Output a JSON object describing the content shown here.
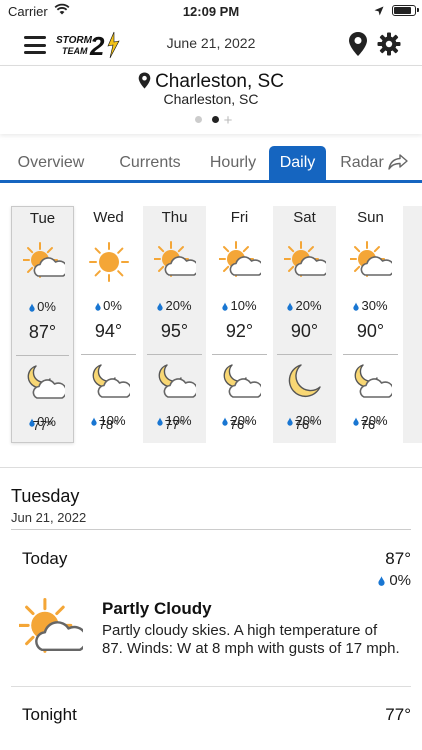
{
  "status_bar": {
    "carrier": "Carrier",
    "time": "12:09 PM",
    "battery_level": 0.9
  },
  "header": {
    "date": "June 21, 2022"
  },
  "location": {
    "title": "Charleston, SC",
    "subtitle": "Charleston, SC",
    "pages": 2,
    "active_page": 1
  },
  "tabs": [
    {
      "label": "Overview"
    },
    {
      "label": "Currents"
    },
    {
      "label": "Hourly"
    },
    {
      "label": "Daily",
      "active": true
    },
    {
      "label": "Radar"
    }
  ],
  "daily": [
    {
      "day": "Tue",
      "day_icon": "partly-cloudy-day-icon",
      "day_precip": "0%",
      "high": "87°",
      "night_icon": "partly-cloudy-night-icon",
      "night_precip": "0%",
      "low": "77°"
    },
    {
      "day": "Wed",
      "day_icon": "sunny-icon",
      "day_precip": "0%",
      "high": "94°",
      "night_icon": "partly-cloudy-night-icon",
      "night_precip": "10%",
      "low": "78°"
    },
    {
      "day": "Thu",
      "day_icon": "partly-cloudy-day-icon",
      "day_precip": "20%",
      "high": "95°",
      "night_icon": "partly-cloudy-night-icon",
      "night_precip": "10%",
      "low": "77°"
    },
    {
      "day": "Fri",
      "day_icon": "partly-cloudy-day-icon",
      "day_precip": "10%",
      "high": "92°",
      "night_icon": "partly-cloudy-night-icon",
      "night_precip": "20%",
      "low": "76°"
    },
    {
      "day": "Sat",
      "day_icon": "partly-cloudy-day-icon",
      "day_precip": "20%",
      "high": "90°",
      "night_icon": "clear-night-icon",
      "night_precip": "20%",
      "low": "76°"
    },
    {
      "day": "Sun",
      "day_icon": "partly-cloudy-day-icon",
      "day_precip": "30%",
      "high": "90°",
      "night_icon": "partly-cloudy-night-icon",
      "night_precip": "20%",
      "low": "76°"
    }
  ],
  "detail": {
    "title": "Tuesday",
    "date": "Jun 21, 2022",
    "today": {
      "label": "Today",
      "high": "87°",
      "precip": "0%",
      "condition": "Partly Cloudy",
      "description": "Partly cloudy skies.  A high temperature of 87.  Winds: W at 8 mph with gusts of 17 mph."
    },
    "tonight": {
      "label": "Tonight",
      "low": "77°"
    }
  },
  "colors": {
    "accent": "#1565c0",
    "sun": "#f4a637",
    "drop": "#1976d2"
  }
}
